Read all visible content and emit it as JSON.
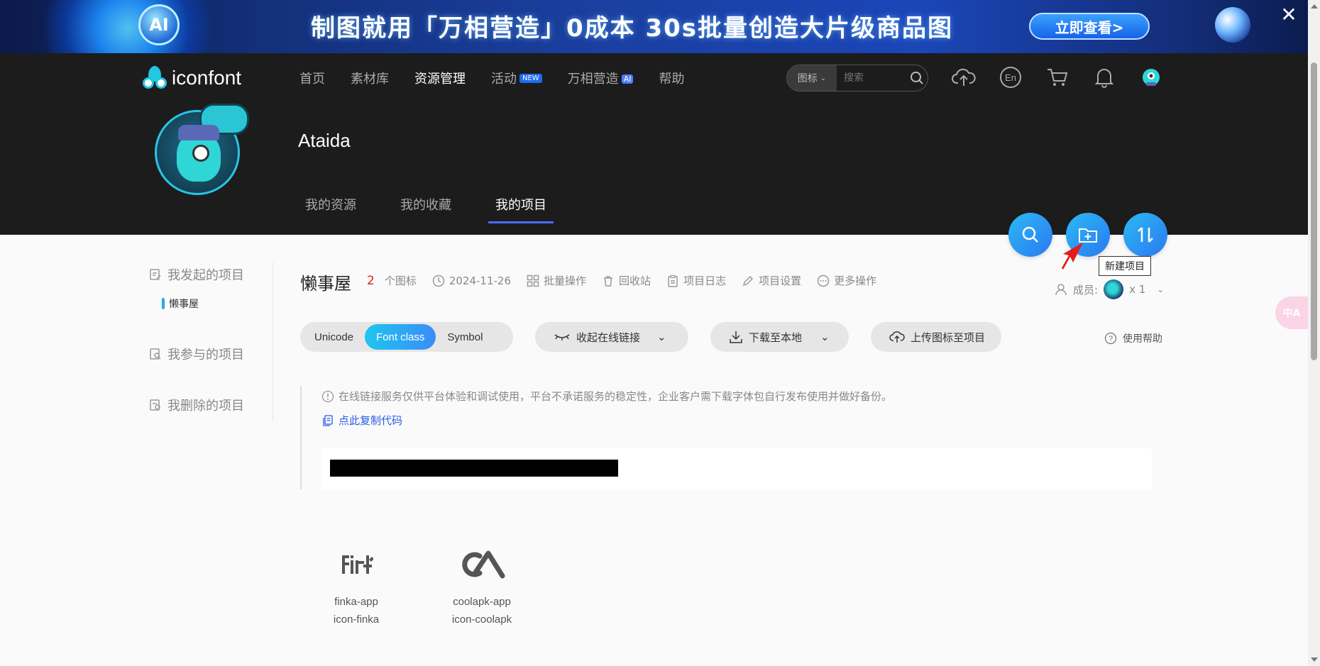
{
  "banner": {
    "badge": "AI",
    "headline": "制图就用「万相营造」0成本 30s批量创造大片级商品图",
    "cta": "立即查看>",
    "close": "✕"
  },
  "header": {
    "logo_text": "iconfont",
    "nav": [
      {
        "label": "首页"
      },
      {
        "label": "素材库"
      },
      {
        "label": "资源管理"
      },
      {
        "label": "活动",
        "badge": "NEW"
      },
      {
        "label": "万相营造",
        "badge": "AI"
      },
      {
        "label": "帮助"
      }
    ],
    "search": {
      "type": "图标",
      "placeholder": "搜索"
    }
  },
  "profile": {
    "username": "Ataida",
    "tabs": [
      "我的资源",
      "我的收藏",
      "我的项目"
    ]
  },
  "fab": {
    "tooltip": "新建项目"
  },
  "sidebar": {
    "initiated": "我发起的项目",
    "project": "懒事屋",
    "joined": "我参与的项目",
    "deleted": "我删除的项目"
  },
  "project": {
    "title": "懒事屋",
    "icon_count": "2",
    "icon_count_label": "个图标",
    "date": "2024-11-26",
    "batch": "批量操作",
    "recycle": "回收站",
    "log": "项目日志",
    "settings": "项目设置",
    "more": "更多操作",
    "members_label": "成员:",
    "members_count": "x 1"
  },
  "toolbar": {
    "formats": [
      "Unicode",
      "Font class",
      "Symbol"
    ],
    "collapse": "收起在线链接",
    "download": "下载至本地",
    "upload": "上传图标至项目",
    "help": "使用帮助"
  },
  "notice": {
    "warning": "在线链接服务仅供平台体验和调试使用，平台不承诺服务的稳定性，企业客户需下载字体包自行发布使用并做好备份。",
    "copy": "点此复制代码"
  },
  "icons": [
    {
      "glyph_text": "𝕗𝕚",
      "name": "finka-app",
      "class": "icon-finka"
    },
    {
      "glyph_text": "",
      "name": "coolapk-app",
      "class": "icon-coolapk"
    }
  ],
  "translate_label": "中A"
}
